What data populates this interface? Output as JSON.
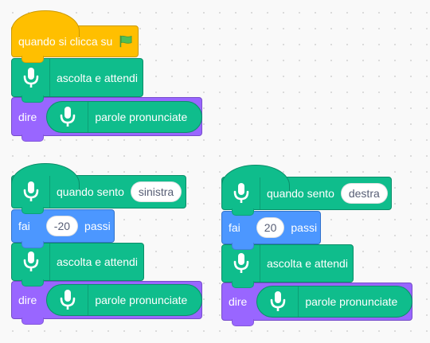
{
  "scripts": [
    {
      "blocks": [
        {
          "kind": "hat-event",
          "text_before": "quando si clicca su",
          "icon": "green-flag-icon"
        },
        {
          "kind": "command",
          "icon": "microphone-icon",
          "text": "ascolta e attendi"
        },
        {
          "kind": "say",
          "text": "dire",
          "reporter_text": "parole pronunciate",
          "reporter_icon": "microphone-icon"
        }
      ]
    },
    {
      "blocks": [
        {
          "kind": "hat-speech",
          "icon": "microphone-icon",
          "text": "quando sento",
          "input": "sinistra"
        },
        {
          "kind": "motion",
          "text_before": "fai",
          "input": "-20",
          "text_after": "passi"
        },
        {
          "kind": "command",
          "icon": "microphone-icon",
          "text": "ascolta e attendi"
        },
        {
          "kind": "say",
          "text": "dire",
          "reporter_text": "parole pronunciate",
          "reporter_icon": "microphone-icon"
        }
      ]
    },
    {
      "blocks": [
        {
          "kind": "hat-speech",
          "icon": "microphone-icon",
          "text": "quando sento",
          "input": "destra"
        },
        {
          "kind": "motion",
          "text_before": "fai",
          "input": "20",
          "text_after": "passi"
        },
        {
          "kind": "command",
          "icon": "microphone-icon",
          "text": "ascolta e attendi"
        },
        {
          "kind": "say",
          "text": "dire",
          "reporter_text": "parole pronunciate",
          "reporter_icon": "microphone-icon"
        }
      ]
    }
  ],
  "colors": {
    "event": "#ffbf00",
    "extension": "#0fbd8c",
    "looks": "#9966ff",
    "motion": "#4c97ff",
    "canvas": "#f9f9f9"
  }
}
